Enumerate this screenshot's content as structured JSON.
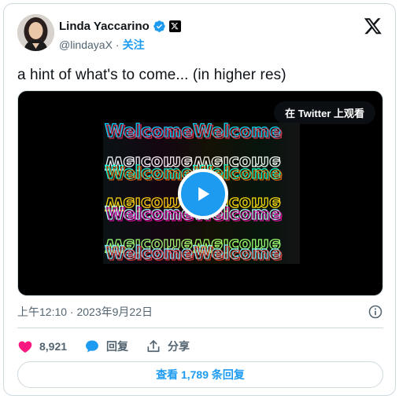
{
  "author": {
    "display_name": "Linda Yaccarino",
    "handle": "@lindayaX",
    "follow_label": "关注",
    "separator": "·"
  },
  "tweet": {
    "text": "a hint of what's to come... (in higher res)",
    "media_overlay_label": "在 Twitter 上观看",
    "timestamp": "上午12:10 · 2023年9月22日"
  },
  "actions": {
    "likes_count": "8,921",
    "reply_label": "回复",
    "share_label": "分享"
  },
  "replies_button_label": "查看 1,789 条回复",
  "icons": {
    "verified": "verified-badge-icon",
    "affiliate": "x-affiliate-badge-icon",
    "logo": "x-logo-icon",
    "play": "play-icon",
    "info": "info-icon",
    "like": "heart-icon",
    "reply": "speech-bubble-icon",
    "share": "share-icon"
  },
  "colors": {
    "accent": "#1d9bf0",
    "like": "#f91880",
    "text_secondary": "#536471",
    "border": "#cfd9de"
  }
}
